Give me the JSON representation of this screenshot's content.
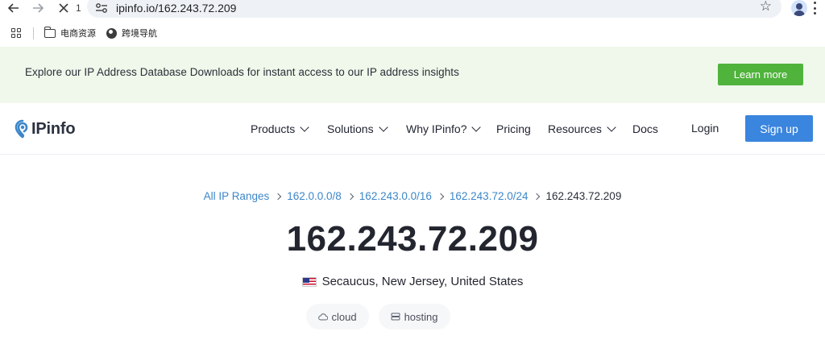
{
  "browser": {
    "tab_count": "1",
    "url": "ipinfo.io/162.243.72.209",
    "bookmarks": [
      {
        "label": "电商资源",
        "icon": "folder-icon"
      },
      {
        "label": "跨境导航",
        "icon": "globe-icon"
      }
    ]
  },
  "banner": {
    "text": "Explore our IP Address Database Downloads for instant access to our IP address insights",
    "button_label": "Learn more"
  },
  "nav": {
    "logo_text": "IPinfo",
    "items": [
      {
        "label": "Products",
        "dropdown": true
      },
      {
        "label": "Solutions",
        "dropdown": true
      },
      {
        "label": "Why IPinfo?",
        "dropdown": true
      },
      {
        "label": "Pricing",
        "dropdown": false
      },
      {
        "label": "Resources",
        "dropdown": true
      },
      {
        "label": "Docs",
        "dropdown": false
      }
    ],
    "login_label": "Login",
    "signup_label": "Sign up"
  },
  "breadcrumb": {
    "links": [
      "All IP Ranges",
      "162.0.0.0/8",
      "162.243.0.0/16",
      "162.243.72.0/24"
    ],
    "current": "162.243.72.209"
  },
  "ip": {
    "address": "162.243.72.209",
    "location": "Secaucus, New Jersey, United States",
    "flag": "us-flag-icon",
    "tags": [
      {
        "label": "cloud",
        "icon": "cloud-icon"
      },
      {
        "label": "hosting",
        "icon": "server-icon"
      }
    ]
  },
  "colors": {
    "banner_bg": "#eff8ea",
    "learn_more": "#4fb33c",
    "signup": "#3a85de",
    "link": "#3c86c9"
  }
}
